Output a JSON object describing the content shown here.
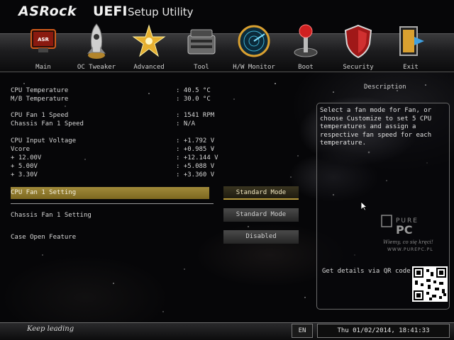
{
  "header": {
    "brand": "ASRock",
    "title_bold": "UEFI",
    "title_rest": "Setup Utility"
  },
  "nav": [
    {
      "label": "Main",
      "icon": "main-icon"
    },
    {
      "label": "OC Tweaker",
      "icon": "rocket-icon"
    },
    {
      "label": "Advanced",
      "icon": "star-icon"
    },
    {
      "label": "Tool",
      "icon": "toolbox-icon"
    },
    {
      "label": "H/W Monitor",
      "icon": "radar-icon"
    },
    {
      "label": "Boot",
      "icon": "joystick-icon"
    },
    {
      "label": "Security",
      "icon": "shield-icon"
    },
    {
      "label": "Exit",
      "icon": "exit-icon"
    }
  ],
  "monitor": {
    "cpu_temp": {
      "label": "CPU Temperature",
      "value": ": 40.5 °C"
    },
    "mb_temp": {
      "label": "M/B Temperature",
      "value": ": 30.0 °C"
    },
    "cpu_fan1": {
      "label": "CPU Fan 1 Speed",
      "value": ": 1541 RPM"
    },
    "chassis_fan1": {
      "label": "Chassis Fan 1 Speed",
      "value": ": N/A"
    },
    "cpu_input_voltage": {
      "label": "CPU Input Voltage",
      "value": ": +1.792 V"
    },
    "vcore": {
      "label": "Vcore",
      "value": ": +0.985 V"
    },
    "v12": {
      "label": "+ 12.00V",
      "value": ": +12.144 V"
    },
    "v5": {
      "label": "+ 5.00V",
      "value": ": +5.088 V"
    },
    "v33": {
      "label": "+ 3.30V",
      "value": ": +3.360 V"
    }
  },
  "settings": {
    "cpu_fan_setting": {
      "label": "CPU Fan 1 Setting",
      "value": "Standard Mode"
    },
    "chassis_fan_setting": {
      "label": "Chassis Fan 1 Setting",
      "value": "Standard Mode"
    },
    "case_open": {
      "label": "Case Open Feature",
      "value": "Disabled"
    }
  },
  "description": {
    "title": "Description",
    "text": "Select a fan mode for Fan, or choose Customize to set 5 CPU temperatures and assign a respective fan speed for each temperature.",
    "qr_label": "Get details via QR code"
  },
  "watermark": {
    "brand": "PURE PC",
    "tagline": "Wiemy, co się kręci!",
    "url": "WWW.PUREPC.PL"
  },
  "footer": {
    "slogan": "Keep leading",
    "language": "EN",
    "datetime": "Thu 01/02/2014, 18:41:33"
  },
  "colors": {
    "accent": "#a08a3a",
    "panel_border": "#6a6a6a"
  }
}
